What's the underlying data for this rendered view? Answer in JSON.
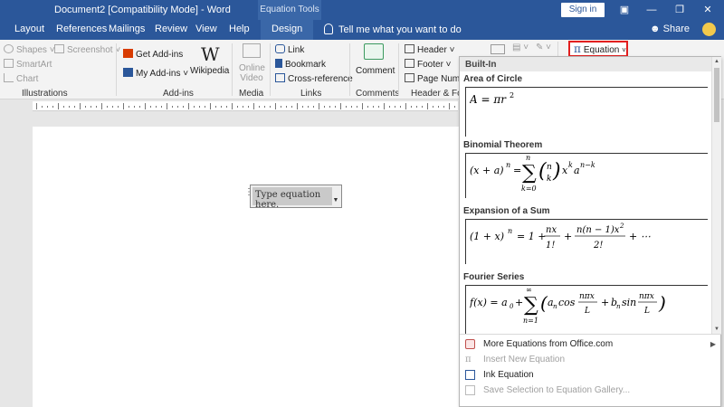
{
  "window": {
    "title": "Document2 [Compatibility Mode] - Word",
    "contextual_tab_group": "Equation Tools",
    "sign_in_label": "Sign in",
    "share_label": "Share"
  },
  "tabs": [
    "Layout",
    "References",
    "Mailings",
    "Review",
    "View",
    "Help",
    "Design"
  ],
  "active_tab": "Design",
  "tell_me_placeholder": "Tell me what you want to do",
  "ribbon": {
    "illustrations": {
      "shapes": "Shapes",
      "screenshot": "Screenshot",
      "smartart": "SmartArt",
      "chart": "Chart",
      "label": "Illustrations"
    },
    "addins": {
      "get": "Get Add-ins",
      "my": "My Add-ins",
      "wikipedia": "Wikipedia",
      "label": "Add-ins"
    },
    "media": {
      "online_video": "Online Video",
      "label": "Media"
    },
    "links": {
      "link": "Link",
      "bookmark": "Bookmark",
      "cross_reference": "Cross-reference",
      "label": "Links"
    },
    "comments": {
      "comment": "Comment",
      "label": "Comments"
    },
    "header_footer": {
      "header": "Header",
      "footer": "Footer",
      "page_number": "Page Number",
      "label": "Header & Foot"
    },
    "equation_button": "Equation"
  },
  "document": {
    "equation_placeholder": "Type equation here."
  },
  "gallery": {
    "section_label": "Built-In",
    "equations": [
      {
        "title": "Area of Circle"
      },
      {
        "title": "Binomial Theorem"
      },
      {
        "title": "Expansion of a Sum"
      },
      {
        "title": "Fourier Series"
      }
    ],
    "menu": [
      {
        "label": "More Equations from Office.com",
        "enabled": true
      },
      {
        "label": "Insert New Equation",
        "enabled": false
      },
      {
        "label": "Ink Equation",
        "enabled": true
      },
      {
        "label": "Save Selection to Equation Gallery...",
        "enabled": false
      }
    ]
  },
  "colors": {
    "title_bar": "#2b579a",
    "highlight_border": "#e21f1f"
  }
}
